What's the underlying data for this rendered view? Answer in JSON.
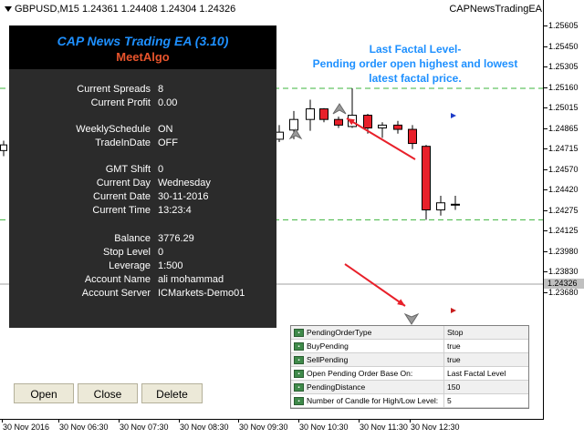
{
  "header": {
    "symbol_info": "GBPUSD,M15  1.24361 1.24408 1.24304 1.24326",
    "ea_name": "CAPNewsTradingEA"
  },
  "price_axis": {
    "labels": [
      "1.25605",
      "1.25450",
      "1.25305",
      "1.25160",
      "1.25015",
      "1.24865",
      "1.24715",
      "1.24570",
      "1.24420",
      "1.24275",
      "1.24125",
      "1.23980",
      "1.23830",
      "1.23680"
    ],
    "current_price": "1.24326"
  },
  "time_axis": {
    "labels": [
      "30 Nov 2016",
      "30 Nov 06:30",
      "30 Nov 07:30",
      "30 Nov 08:30",
      "30 Nov 09:30",
      "30 Nov 10:30",
      "30 Nov 11:30",
      "30 Nov 12:30"
    ]
  },
  "panel": {
    "title": "CAP News Trading EA (3.10)",
    "subtitle": "MeetAlgo",
    "rows": [
      {
        "label": "Current Spreads",
        "value": "8"
      },
      {
        "label": "Current Profit",
        "value": "0.00"
      },
      {
        "label": "WeeklySchedule",
        "value": "ON"
      },
      {
        "label": "TradeInDate",
        "value": "OFF"
      },
      {
        "label": "GMT Shift",
        "value": "0"
      },
      {
        "label": "Current Day",
        "value": "Wednesday"
      },
      {
        "label": "Current Date",
        "value": "30-11-2016"
      },
      {
        "label": "Current Time",
        "value": "13:23:4"
      },
      {
        "label": "Balance",
        "value": "3776.29"
      },
      {
        "label": "Stop Level",
        "value": "0"
      },
      {
        "label": "Leverage",
        "value": "1:500"
      },
      {
        "label": "Account Name",
        "value": "ali mohammad"
      },
      {
        "label": "Account Server",
        "value": "ICMarkets-Demo01"
      }
    ]
  },
  "buttons": {
    "open": "Open",
    "close": "Close",
    "delete": "Delete"
  },
  "annotation": {
    "line1": "Last Factal Level-",
    "line2": "Pending order open highest and lowest",
    "line3": "latest factal price."
  },
  "settings": [
    {
      "name": "PendingOrderType",
      "value": "Stop"
    },
    {
      "name": "BuyPending",
      "value": "true"
    },
    {
      "name": "SellPending",
      "value": "true"
    },
    {
      "name": "Open Pending Order Base On:",
      "value": "Last Factal Level"
    },
    {
      "name": "PendingDistance",
      "value": "150"
    },
    {
      "name": "Number of Candle for High/Low Level:",
      "value": "5"
    }
  ],
  "colors": {
    "bull": "#ffffff",
    "bear": "#e8202a",
    "level_line": "#3cb43c",
    "arrow": "#e8202a",
    "accent": "#1e90ff"
  },
  "chart_data": {
    "type": "candlestick",
    "candles": [
      {
        "o": 1.24865,
        "h": 1.25,
        "l": 1.248,
        "c": 1.2494
      },
      {
        "o": 1.2494,
        "h": 1.2508,
        "l": 1.2486,
        "c": 1.25015
      },
      {
        "o": 1.25015,
        "h": 1.2502,
        "l": 1.2492,
        "c": 1.2494
      },
      {
        "o": 1.2494,
        "h": 1.2496,
        "l": 1.2488,
        "c": 1.249
      },
      {
        "o": 1.2489,
        "h": 1.2516,
        "l": 1.2488,
        "c": 1.2497
      },
      {
        "o": 1.2497,
        "h": 1.2498,
        "l": 1.2484,
        "c": 1.2488
      },
      {
        "o": 1.2488,
        "h": 1.2492,
        "l": 1.2481,
        "c": 1.249
      },
      {
        "o": 1.249,
        "h": 1.2493,
        "l": 1.2484,
        "c": 1.2487
      },
      {
        "o": 1.2487,
        "h": 1.249,
        "l": 1.2473,
        "c": 1.2477
      },
      {
        "o": 1.2475,
        "h": 1.2476,
        "l": 1.2423,
        "c": 1.243
      },
      {
        "o": 1.243,
        "h": 1.244,
        "l": 1.2426,
        "c": 1.2435
      },
      {
        "o": 1.2434,
        "h": 1.244,
        "l": 1.243,
        "c": 1.2434
      },
      {
        "o": 1.2436,
        "h": 1.2441,
        "l": 1.243,
        "c": 1.2433
      }
    ],
    "extra_candle_left": {
      "o": 1.2472,
      "h": 1.2479,
      "l": 1.2468,
      "c": 1.2476
    },
    "extra_candle_mid": {
      "o": 1.248,
      "h": 1.249,
      "l": 1.2478,
      "c": 1.2485
    },
    "levels": [
      1.2516,
      1.2423
    ]
  }
}
